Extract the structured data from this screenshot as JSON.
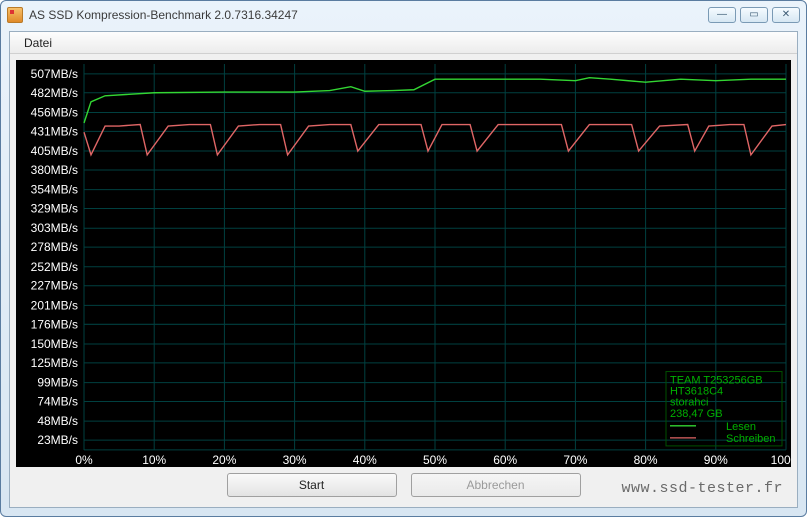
{
  "window": {
    "title": "AS SSD Kompression-Benchmark 2.0.7316.34247",
    "min_symbol": "—",
    "max_symbol": "▭",
    "close_symbol": "✕"
  },
  "menu": {
    "file": "Datei"
  },
  "buttons": {
    "start": "Start",
    "cancel": "Abbrechen"
  },
  "legend": {
    "drive_model": "TEAM T253256GB",
    "controller": "HT3618C4",
    "driver": "storahci",
    "capacity": "238,47 GB",
    "read": "Lesen",
    "write": "Schreiben"
  },
  "watermark": "www.ssd-tester.fr",
  "chart_data": {
    "type": "line",
    "xlabel": "",
    "ylabel": "",
    "x_unit": "%",
    "y_unit": "MB/s",
    "xlim": [
      0,
      100
    ],
    "ylim": [
      10,
      520
    ],
    "y_ticks": [
      23,
      48,
      74,
      99,
      125,
      150,
      176,
      201,
      227,
      252,
      278,
      303,
      329,
      354,
      380,
      405,
      431,
      456,
      482,
      507
    ],
    "y_tick_labels": [
      "23MB/s",
      "48MB/s",
      "74MB/s",
      "99MB/s",
      "125MB/s",
      "150MB/s",
      "176MB/s",
      "201MB/s",
      "227MB/s",
      "252MB/s",
      "278MB/s",
      "303MB/s",
      "329MB/s",
      "354MB/s",
      "380MB/s",
      "405MB/s",
      "431MB/s",
      "456MB/s",
      "482MB/s",
      "507MB/s"
    ],
    "x_ticks": [
      0,
      10,
      20,
      30,
      40,
      50,
      60,
      70,
      80,
      90,
      100
    ],
    "x_tick_labels": [
      "0%",
      "10%",
      "20%",
      "30%",
      "40%",
      "50%",
      "60%",
      "70%",
      "80%",
      "90%",
      "100%"
    ],
    "series": [
      {
        "name": "Lesen",
        "color": "#33d633",
        "x": [
          0,
          1,
          3,
          10,
          20,
          30,
          35,
          38,
          40,
          44,
          47,
          50,
          55,
          60,
          65,
          70,
          72,
          75,
          80,
          85,
          90,
          95,
          100
        ],
        "y": [
          442,
          470,
          478,
          482,
          483,
          483,
          485,
          490,
          484,
          485,
          486,
          500,
          500,
          500,
          500,
          498,
          502,
          500,
          496,
          500,
          498,
          500,
          500
        ]
      },
      {
        "name": "Schreiben",
        "color": "#e06666",
        "x": [
          0,
          1,
          3,
          5,
          8,
          9,
          12,
          15,
          18,
          19,
          22,
          25,
          28,
          29,
          32,
          35,
          38,
          39,
          42,
          45,
          48,
          49,
          51,
          55,
          56,
          59,
          62,
          65,
          68,
          69,
          72,
          75,
          78,
          79,
          82,
          86,
          87,
          89,
          92,
          94,
          95,
          98,
          100
        ],
        "y": [
          430,
          400,
          438,
          438,
          440,
          400,
          438,
          440,
          440,
          400,
          438,
          440,
          440,
          400,
          438,
          440,
          440,
          405,
          440,
          440,
          440,
          405,
          440,
          440,
          405,
          440,
          440,
          440,
          440,
          405,
          440,
          440,
          440,
          405,
          438,
          440,
          405,
          438,
          440,
          440,
          400,
          438,
          440
        ]
      }
    ]
  }
}
